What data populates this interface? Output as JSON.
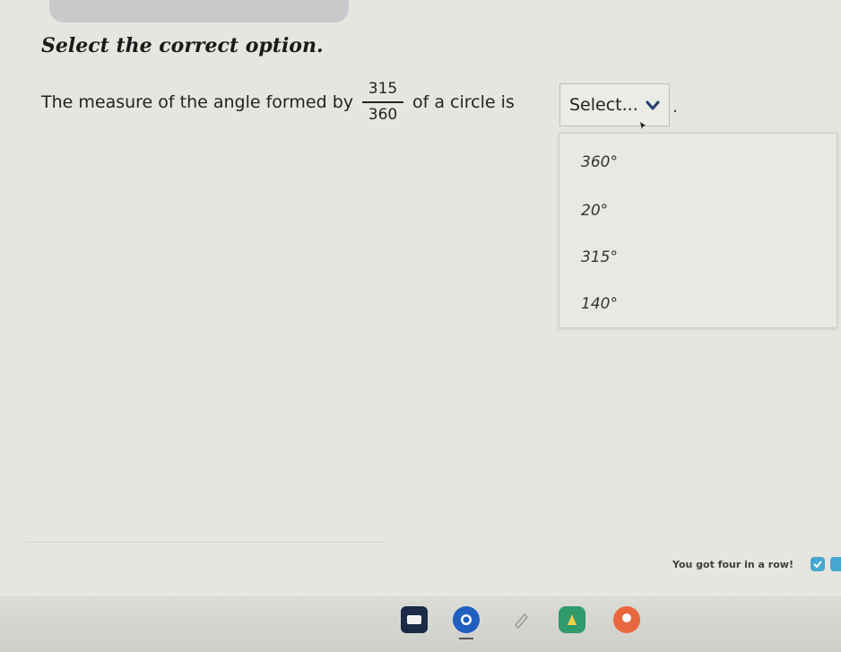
{
  "instruction": "Select the correct option.",
  "question": {
    "prefix": "The measure of the angle formed by",
    "numerator": "315",
    "denominator": "360",
    "suffix": "of a circle is",
    "end_punct": "."
  },
  "select": {
    "current": "Select...",
    "options": [
      "360°",
      "20°",
      "315°",
      "140°"
    ]
  },
  "footer": {
    "message": "You got four in a row!"
  },
  "taskbar": {
    "icons": [
      "files-icon",
      "chrome-icon",
      "pen-icon",
      "drive-icon",
      "assistant-icon"
    ]
  },
  "colors": {
    "background": "#e6e6e0",
    "accent": "#46a7cf"
  }
}
